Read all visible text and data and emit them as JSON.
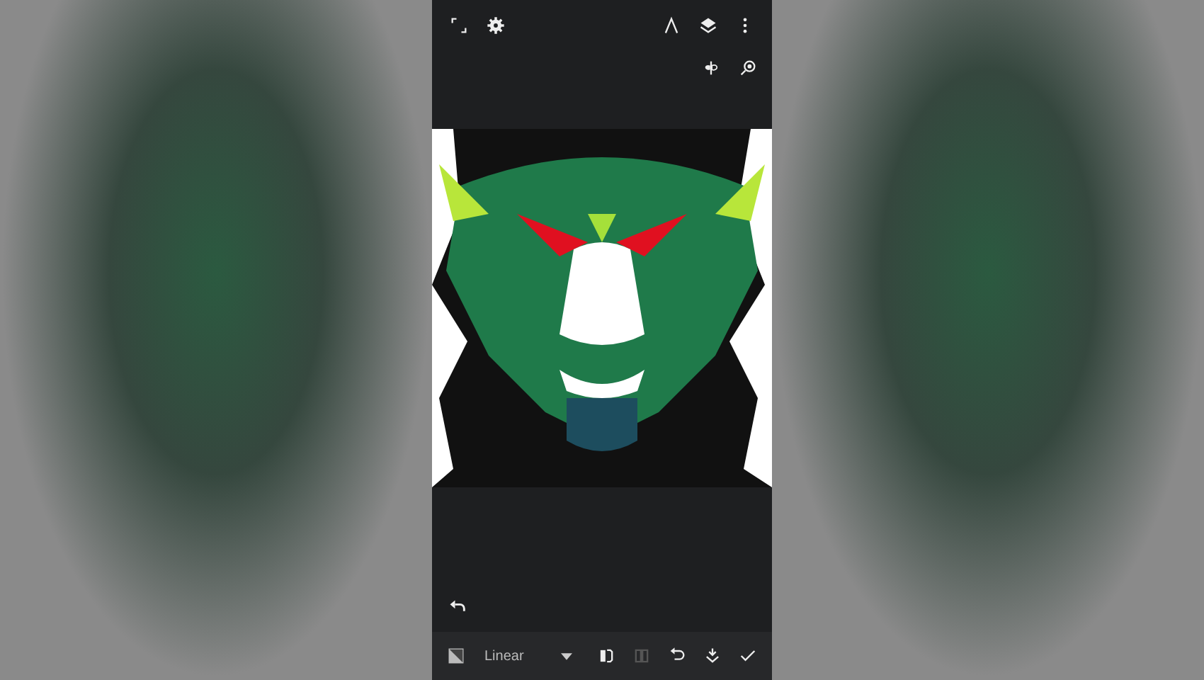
{
  "top_bar": {
    "left_tools": [
      {
        "kind": "fullscreen",
        "disabled": false
      },
      {
        "kind": "settings",
        "disabled": false
      }
    ],
    "right_tools": [
      {
        "kind": "ruler",
        "disabled": false
      },
      {
        "kind": "layers",
        "disabled": false
      },
      {
        "kind": "more",
        "disabled": false
      }
    ]
  },
  "symmetry_tools": [
    {
      "kind": "symmetry",
      "disabled": false
    },
    {
      "kind": "zoom",
      "disabled": false
    }
  ],
  "bottom_bar": {
    "mode_dropdown": {
      "value": "Linear"
    },
    "tools": [
      {
        "kind": "flip-horizontal",
        "disabled": false
      },
      {
        "kind": "flip-vertical",
        "disabled": true
      },
      {
        "kind": "rotate",
        "disabled": false
      },
      {
        "kind": "reset",
        "disabled": false
      },
      {
        "kind": "confirm",
        "disabled": false
      }
    ]
  }
}
